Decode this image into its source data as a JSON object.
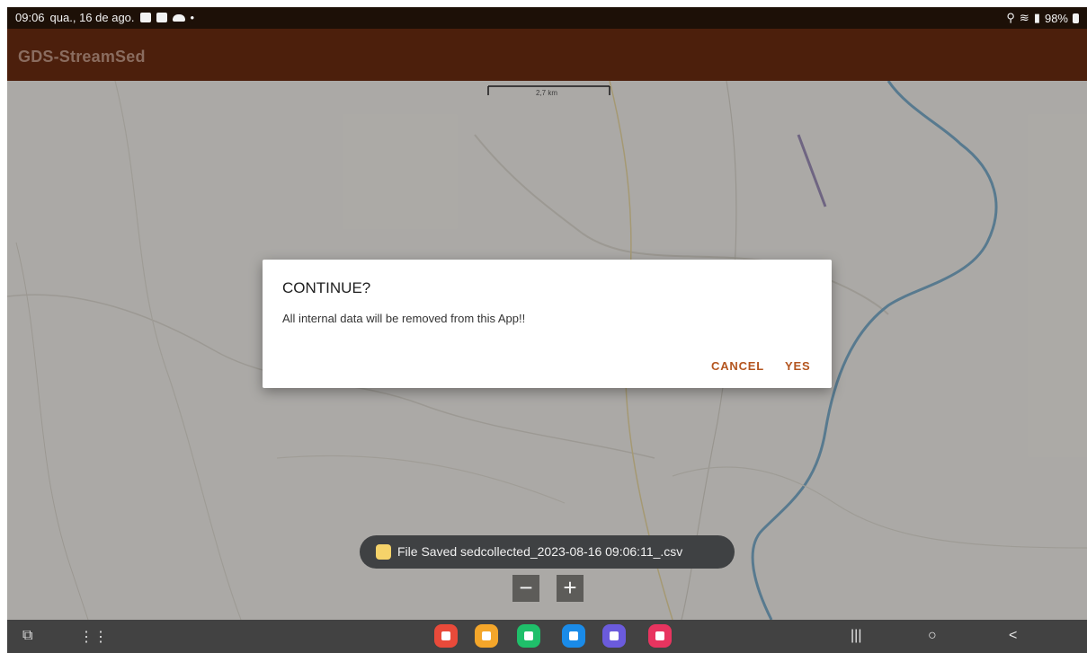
{
  "status_bar": {
    "time": "09:06",
    "date": "qua., 16 de ago.",
    "battery": "98%",
    "icons_left": [
      "gallery-icon",
      "screenshot-icon",
      "cloud-icon",
      "dot-icon"
    ],
    "icons_right": [
      "location-icon",
      "wifi-icon",
      "signal-icon",
      "battery-icon"
    ]
  },
  "app_bar": {
    "title": "GDS-StreamSed"
  },
  "map": {
    "scale_label": "2,7 km"
  },
  "dialog": {
    "title": "CONTINUE?",
    "message": "All internal data will be removed from this App!!",
    "cancel_label": "CANCEL",
    "yes_label": "YES"
  },
  "toast": {
    "text": "File Saved sedcollected_2023-08-16 09:06:11_.csv"
  },
  "zoom": {
    "out_label": "−",
    "in_label": "+"
  },
  "nav": {
    "recents_label": "|||",
    "home_label": "○",
    "back_label": "<"
  },
  "dock_apps": [
    {
      "name": "notes-app-icon",
      "color": "#e94a3a"
    },
    {
      "name": "files-app-icon",
      "color": "#f4a62a"
    },
    {
      "name": "phone-app-icon",
      "color": "#1fbf6a"
    },
    {
      "name": "messages-app-icon",
      "color": "#1a8be8"
    },
    {
      "name": "browser-app-icon",
      "color": "#6b5bdc"
    },
    {
      "name": "camera-app-icon",
      "color": "#e8345f"
    }
  ],
  "colors": {
    "app_bar": "#4c1f0c",
    "accent_button": "#b4551f",
    "river": "#7aa9c6"
  }
}
